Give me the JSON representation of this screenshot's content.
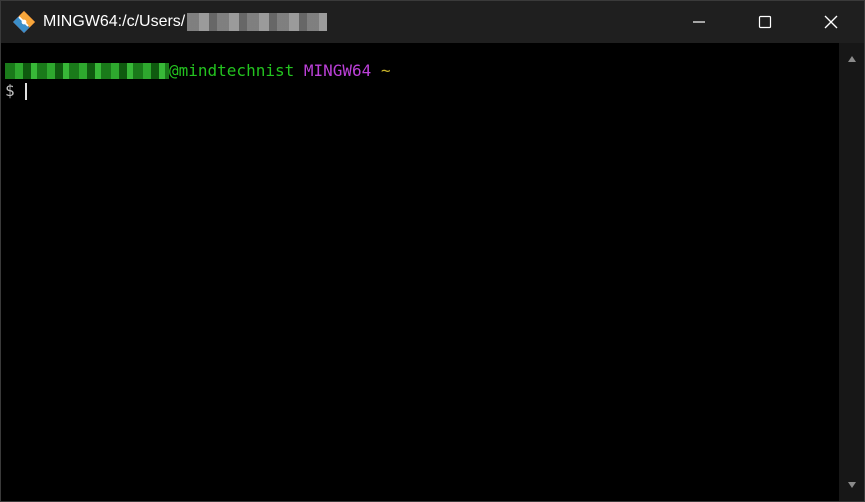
{
  "window": {
    "title": "MINGW64:/c/Users/",
    "controls": {
      "minimize": "minimize",
      "maximize": "maximize",
      "close": "close"
    }
  },
  "terminal": {
    "host_suffix": "@mindtechnist",
    "shell": "MINGW64",
    "path": "~",
    "prompt_symbol": "$"
  },
  "colors": {
    "host": "#23c21f",
    "shell": "#bb40d8",
    "path": "#c8b32a",
    "background": "#000000",
    "titlebar": "#1f1f1f"
  },
  "icons": {
    "app": "git-diamond-icon",
    "minimize": "minimize-icon",
    "maximize": "maximize-icon",
    "close": "close-icon",
    "scroll_up": "chevron-up-icon",
    "scroll_down": "chevron-down-icon"
  }
}
